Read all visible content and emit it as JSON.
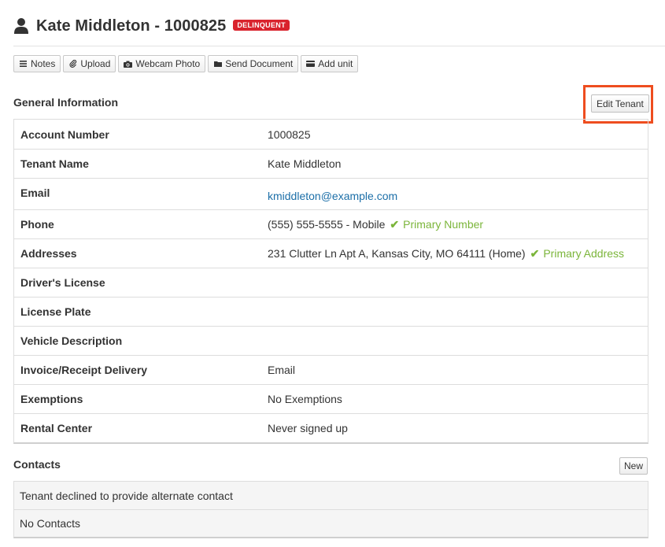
{
  "header": {
    "title": "Kate Middleton - 1000825",
    "status_badge": "DELINQUENT"
  },
  "toolbar": {
    "buttons": [
      {
        "label": "Notes",
        "icon": "list-icon"
      },
      {
        "label": "Upload",
        "icon": "paperclip-icon"
      },
      {
        "label": "Webcam Photo",
        "icon": "camera-icon"
      },
      {
        "label": "Send Document",
        "icon": "folder-icon"
      },
      {
        "label": "Add unit",
        "icon": "card-icon"
      }
    ]
  },
  "general": {
    "title": "General Information",
    "edit_label": "Edit Tenant",
    "rows": [
      {
        "label": "Account Number",
        "value": "1000825"
      },
      {
        "label": "Tenant Name",
        "value": "Kate Middleton"
      },
      {
        "label": "Email",
        "value": "kmiddleton@example.com"
      },
      {
        "label": "Phone",
        "value": "(555) 555-5555 - Mobile",
        "tag": "Primary Number"
      },
      {
        "label": "Addresses",
        "value": "231 Clutter Ln Apt A, Kansas City, MO 64111 (Home)",
        "tag": "Primary Address"
      },
      {
        "label": "Driver's License",
        "value": ""
      },
      {
        "label": "License Plate",
        "value": ""
      },
      {
        "label": "Vehicle Description",
        "value": ""
      },
      {
        "label": "Invoice/Receipt Delivery",
        "value": "Email"
      },
      {
        "label": "Exemptions",
        "value": "No Exemptions"
      },
      {
        "label": "Rental Center",
        "value": "Never signed up"
      }
    ]
  },
  "contacts": {
    "title": "Contacts",
    "new_label": "New",
    "rows": [
      "Tenant declined to provide alternate contact",
      "No Contacts"
    ]
  },
  "colors": {
    "badge": "#d9232d",
    "link": "#1c6fa8",
    "primary": "#7bb53a",
    "highlight": "#ee4d1f"
  }
}
